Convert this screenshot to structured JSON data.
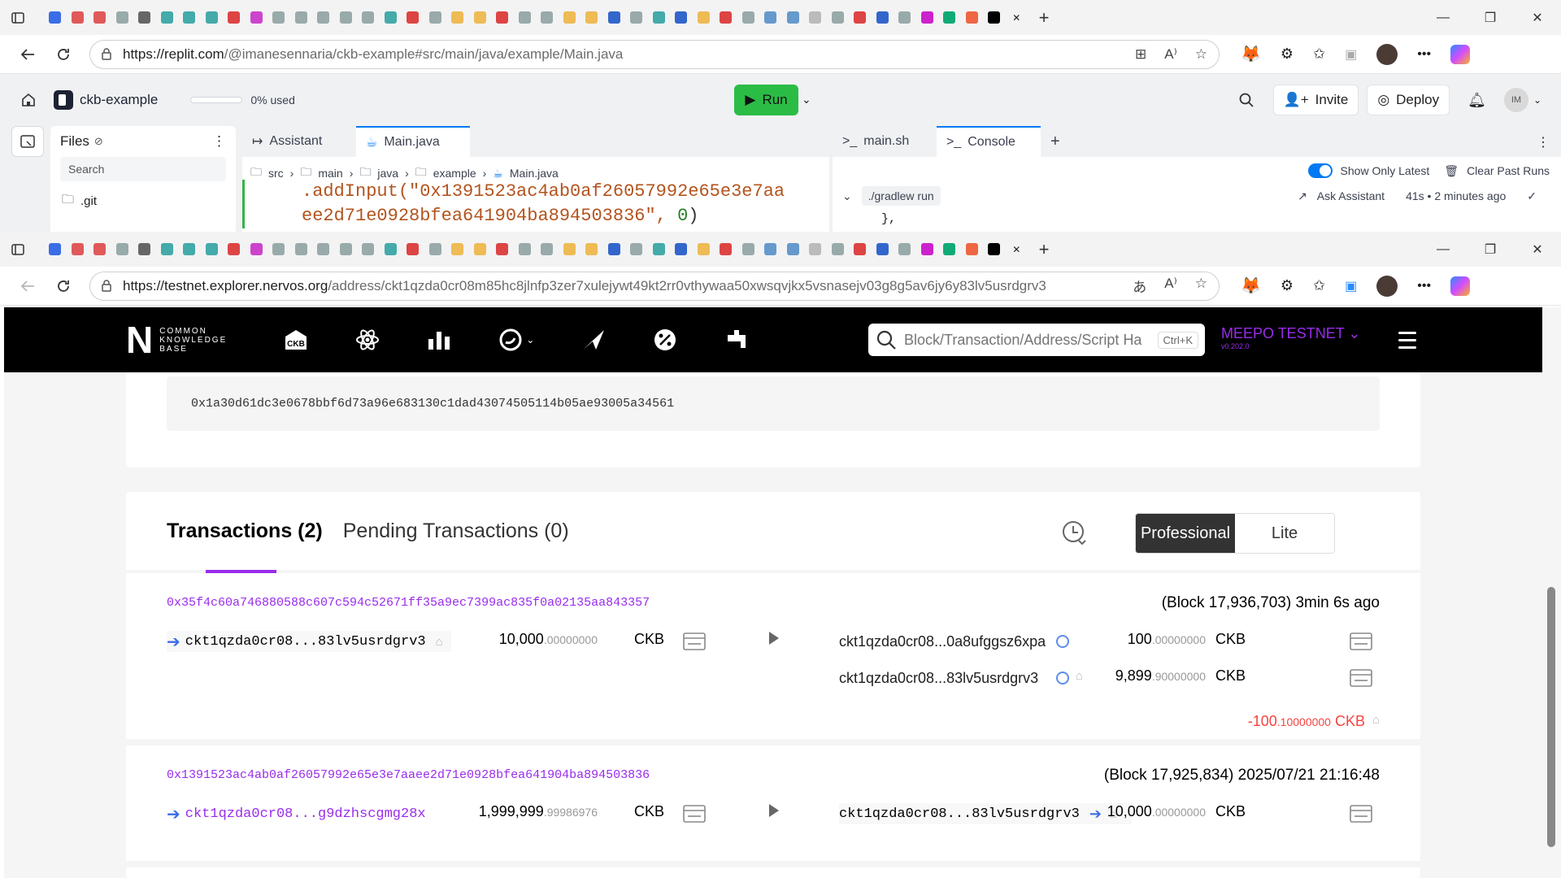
{
  "browser1": {
    "url_domain": "https://replit.com",
    "url_path": "/@imanesennaria/ckb-example#src/main/java/example/Main.java"
  },
  "replit": {
    "project_name": "ckb-example",
    "usage": "0% used",
    "run_label": "Run",
    "invite_label": "Invite",
    "deploy_label": "Deploy",
    "avatar_initials": "IM",
    "files_title": "Files",
    "search_placeholder": "Search",
    "git_folder": ".git",
    "tabs": [
      {
        "label": "Assistant"
      },
      {
        "label": "Main.java"
      }
    ],
    "breadcrumb": [
      "src",
      "main",
      "java",
      "example",
      "Main.java"
    ],
    "code_line1": ".addInput(\"0x1391523ac4ab0af26057992e65e3e7aa",
    "code_line2": "ee2d71e0928bfea641904ba894503836\", ",
    "code_line2_num": "0",
    "code_line2_end": ")",
    "console_tabs": [
      {
        "label": "main.sh"
      },
      {
        "label": "Console"
      }
    ],
    "show_only_latest": "Show Only Latest",
    "clear_past_runs": "Clear Past Runs",
    "gradle_cmd": "./gradlew run",
    "ask_assistant": "Ask Assistant",
    "run_time": "41s • 2 minutes ago",
    "console_brace": "},"
  },
  "browser2": {
    "url_domain": "https://testnet.explorer.nervos.org",
    "url_path": "/address/ckt1qzda0cr08m85hc8jlnfp3zer7xulejywt49kt2rr0vthywaa50xwsqvjkx5vsnasejv03g8g5av6jy6y83lv5usrdgrv3"
  },
  "explorer": {
    "logo_n": "N",
    "logo_words": [
      "COMMON",
      "KNOWLEDGE",
      "BASE"
    ],
    "nav_icons": [
      "ckb-icon",
      "atom-icon",
      "chart-icon",
      "token-icon",
      "rocket-icon",
      "percent-icon",
      "faucet-icon"
    ],
    "ckb_icon_text": "CKB",
    "search_placeholder": "Block/Transaction/Address/Script Ha",
    "search_shortcut": "Ctrl+K",
    "network": "MEEPO TESTNET",
    "version": "v0.202.0",
    "lock_hash": "0x1a30d61dc3e0678bbf6d73a96e683130c1dad43074505114b05ae93005a34561",
    "tab_transactions": "Transactions (2)",
    "tab_pending": "Pending Transactions (0)",
    "mode_professional": "Professional",
    "mode_lite": "Lite",
    "transactions": [
      {
        "hash": "0x35f4c60a746880588c607c594c52671ff35a9ec7399ac835f0a02135aa843357",
        "meta": "(Block 17,936,703) 3min 6s ago",
        "input_addr": "ckt1qzda0cr08...83lv5usrdgrv3",
        "input_int": "10,000",
        "input_dec": ".00000000",
        "outputs": [
          {
            "addr": "ckt1qzda0cr08...0a8ufggsz6xpa",
            "int": "100",
            "dec": ".00000000"
          },
          {
            "addr": "ckt1qzda0cr08...83lv5usrdgrv3",
            "int": "9,899",
            "dec": ".90000000"
          }
        ],
        "net_int": "-100",
        "net_dec": ".10000000"
      },
      {
        "hash": "0x1391523ac4ab0af26057992e65e3e7aaee2d71e0928bfea641904ba894503836",
        "meta": "(Block 17,925,834) 2025/07/21 21:16:48",
        "input_addr": "ckt1qzda0cr08...g9dzhscgmg28x",
        "input_int": "1,999,999",
        "input_dec": ".99986976",
        "outputs": [
          {
            "addr": "ckt1qzda0cr08...83lv5usrdgrv3",
            "int": "10,000",
            "dec": ".00000000"
          }
        ]
      }
    ],
    "unit": "CKB"
  },
  "colors": {
    "accent": "#9a2cec",
    "run": "#2bbc46",
    "negative": "#f6433f"
  }
}
